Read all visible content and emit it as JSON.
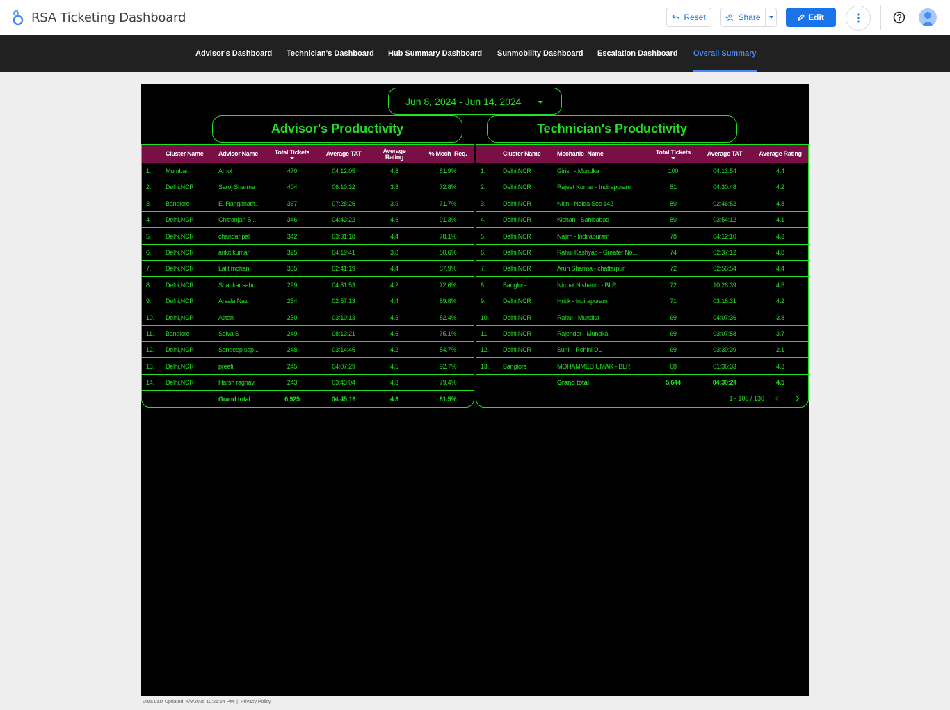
{
  "app": {
    "title": "RSA Ticketing Dashboard"
  },
  "toolbar": {
    "reset_label": "Reset",
    "share_label": "Share",
    "edit_label": "Edit"
  },
  "nav": {
    "tabs": [
      {
        "label": "Advisor's Dashboard"
      },
      {
        "label": "Technician's Dashboard"
      },
      {
        "label": "Hub Summary Dashboard"
      },
      {
        "label": "Sunmobility Dashboard"
      },
      {
        "label": "Escalation Dashboard"
      },
      {
        "label": "Overall Summary",
        "active": true
      }
    ]
  },
  "date_range": "Jun 8, 2024 - Jun 14, 2024",
  "advisor": {
    "title": "Advisor's Productivity",
    "headers": [
      "Cluster Name",
      "Advisor Name",
      "Total Tickets",
      "Average TAT",
      "Average Rating",
      "% Mech_Req."
    ],
    "rows": [
      [
        "1.",
        "Mumbai",
        "Amol",
        "470",
        "04:12:05",
        "4.8",
        "81.9%"
      ],
      [
        "2.",
        "Delhi,NCR",
        "Saroj Sharma",
        "404",
        "06:10:32",
        "3.8",
        "72.8%"
      ],
      [
        "3.",
        "Banglore",
        "E. Ranganath...",
        "367",
        "07:28:26",
        "3.9",
        "71.7%"
      ],
      [
        "4.",
        "Delhi,NCR",
        "Chitranjan S...",
        "346",
        "04:43:22",
        "4.6",
        "91.3%"
      ],
      [
        "5.",
        "Delhi,NCR",
        "chandar pal",
        "342",
        "03:31:18",
        "4.4",
        "78.1%"
      ],
      [
        "6.",
        "Delhi,NCR",
        "ankit kumar",
        "325",
        "04:19:41",
        "3.8",
        "80.6%"
      ],
      [
        "7.",
        "Delhi,NCR",
        "Lalit mohan",
        "305",
        "02:41:19",
        "4.4",
        "87.9%"
      ],
      [
        "8.",
        "Delhi,NCR",
        "Shankar sahu",
        "299",
        "04:31:53",
        "4.2",
        "72.6%"
      ],
      [
        "9.",
        "Delhi,NCR",
        "Arsala Naz",
        "254",
        "02:57:13",
        "4.4",
        "89.8%"
      ],
      [
        "10.",
        "Delhi,NCR",
        "Atitan",
        "250",
        "03:10:13",
        "4.3",
        "82.4%"
      ],
      [
        "11.",
        "Banglore",
        "Selva S",
        "249",
        "08:13:21",
        "4.6",
        "75.1%"
      ],
      [
        "12.",
        "Delhi,NCR",
        "Sandeep sap...",
        "248",
        "03:14:46",
        "4.2",
        "84.7%"
      ],
      [
        "13.",
        "Delhi,NCR",
        "preeti",
        "245",
        "04:07:29",
        "4.5",
        "92.7%"
      ],
      [
        "14.",
        "Delhi,NCR",
        "Harsh raghav",
        "243",
        "03:43:04",
        "4.3",
        "79.4%"
      ]
    ],
    "total": {
      "label": "Grand total",
      "tickets": "6,925",
      "tat": "04:45:16",
      "rating": "4.3",
      "mech": "81.5%"
    }
  },
  "technician": {
    "title": "Technician's Productivity",
    "headers": [
      "Cluster Name",
      "Mechanic_Name",
      "Total Tickets",
      "Average TAT",
      "Average Rating"
    ],
    "rows": [
      [
        "1.",
        "Delhi,NCR",
        "Girish - Mundka",
        "100",
        "04:13:54",
        "4.4"
      ],
      [
        "2.",
        "Delhi,NCR",
        "Rajeet Kumar - Indirapuram",
        "81",
        "04:30:48",
        "4.2"
      ],
      [
        "3.",
        "Delhi,NCR",
        "Nitin - Noida Sec 142",
        "80",
        "02:46:52",
        "4.8"
      ],
      [
        "4.",
        "Delhi,NCR",
        "Kishan - Sahibabad",
        "80",
        "03:54:12",
        "4.1"
      ],
      [
        "5.",
        "Delhi,NCR",
        "Najim - Indirapuram",
        "78",
        "04:12:10",
        "4.3"
      ],
      [
        "6.",
        "Delhi,NCR",
        "Rahul Kashyap - Greater No...",
        "74",
        "02:37:12",
        "4.8"
      ],
      [
        "7.",
        "Delhi,NCR",
        "Arun Sharma - chattarpur",
        "72",
        "02:56:54",
        "4.4"
      ],
      [
        "8.",
        "Banglore",
        "Nirmal Nishanth - BLR",
        "72",
        "10:26:39",
        "4.5"
      ],
      [
        "9.",
        "Delhi,NCR",
        "Hritik - Indirapuram",
        "71",
        "03:16:31",
        "4.2"
      ],
      [
        "10.",
        "Delhi,NCR",
        "Rahul - Mundka",
        "69",
        "04:07:36",
        "3.8"
      ],
      [
        "11.",
        "Delhi,NCR",
        "Rajender - Mundka",
        "69",
        "03:07:58",
        "3.7"
      ],
      [
        "12.",
        "Delhi,NCR",
        "Sunil - Rohini DL",
        "69",
        "03:39:39",
        "2.1"
      ],
      [
        "13.",
        "Banglore",
        "MOHAMMED UMAR - BLR",
        "68",
        "01:36:33",
        "4.3"
      ]
    ],
    "total": {
      "label": "Grand total",
      "tickets": "5,644",
      "tat": "04:30:24",
      "rating": "4.5"
    },
    "pagination": "1 - 100 / 130"
  },
  "footer": {
    "updated": "Data Last Updated: 4/9/2025 10:25:54 PM",
    "separator": "|",
    "privacy": "Privacy Policy"
  },
  "colors": {
    "accent": "#21e221",
    "header_bg": "#7a0f48",
    "nav_bg": "#212121",
    "active_tab": "#4a8af4",
    "edit_button": "#1a73e8"
  },
  "icons": [
    "looker-studio-logo-icon",
    "undo-icon",
    "person-add-icon",
    "edit-pencil-icon",
    "more-vert-icon",
    "help-icon",
    "account-avatar-icon",
    "chevron-left-icon",
    "chevron-right-icon"
  ]
}
